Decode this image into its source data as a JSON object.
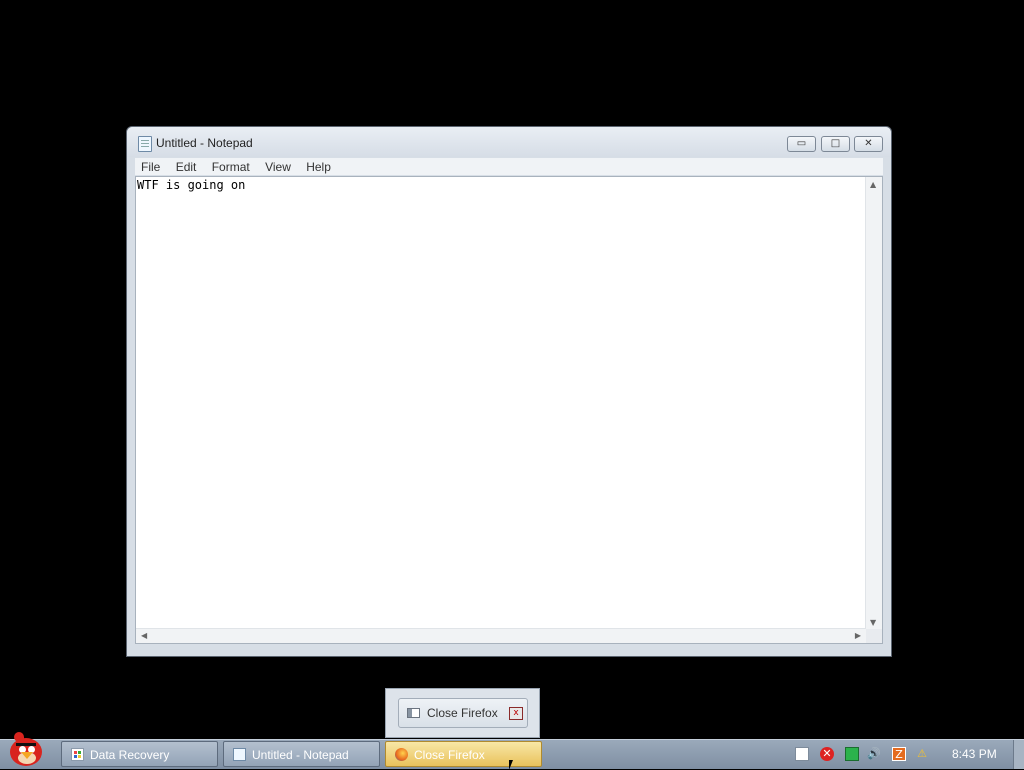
{
  "window": {
    "title": "Untitled - Notepad",
    "buttons": {
      "minimize": "▭",
      "maximize": "□",
      "close": "✕"
    },
    "menu": [
      "File",
      "Edit",
      "Format",
      "View",
      "Help"
    ],
    "content": "WTF is going on"
  },
  "popup": {
    "label": "Close Firefox",
    "close": "x"
  },
  "taskbar": {
    "items": [
      {
        "label": "Data Recovery",
        "icon": "windows-icon"
      },
      {
        "label": "Untitled - Notepad",
        "icon": "notepad-icon"
      },
      {
        "label": "Close Firefox",
        "icon": "firefox-icon"
      }
    ],
    "tray": [
      "windows-flag-icon",
      "error-icon",
      "network-icon",
      "volume-icon",
      "app-icon",
      "warning-icon"
    ],
    "clock": "8:43 PM"
  },
  "colors": {
    "desktop": "#000000",
    "taskbar": "#8d9db0",
    "active_task": "#f0d27a"
  }
}
